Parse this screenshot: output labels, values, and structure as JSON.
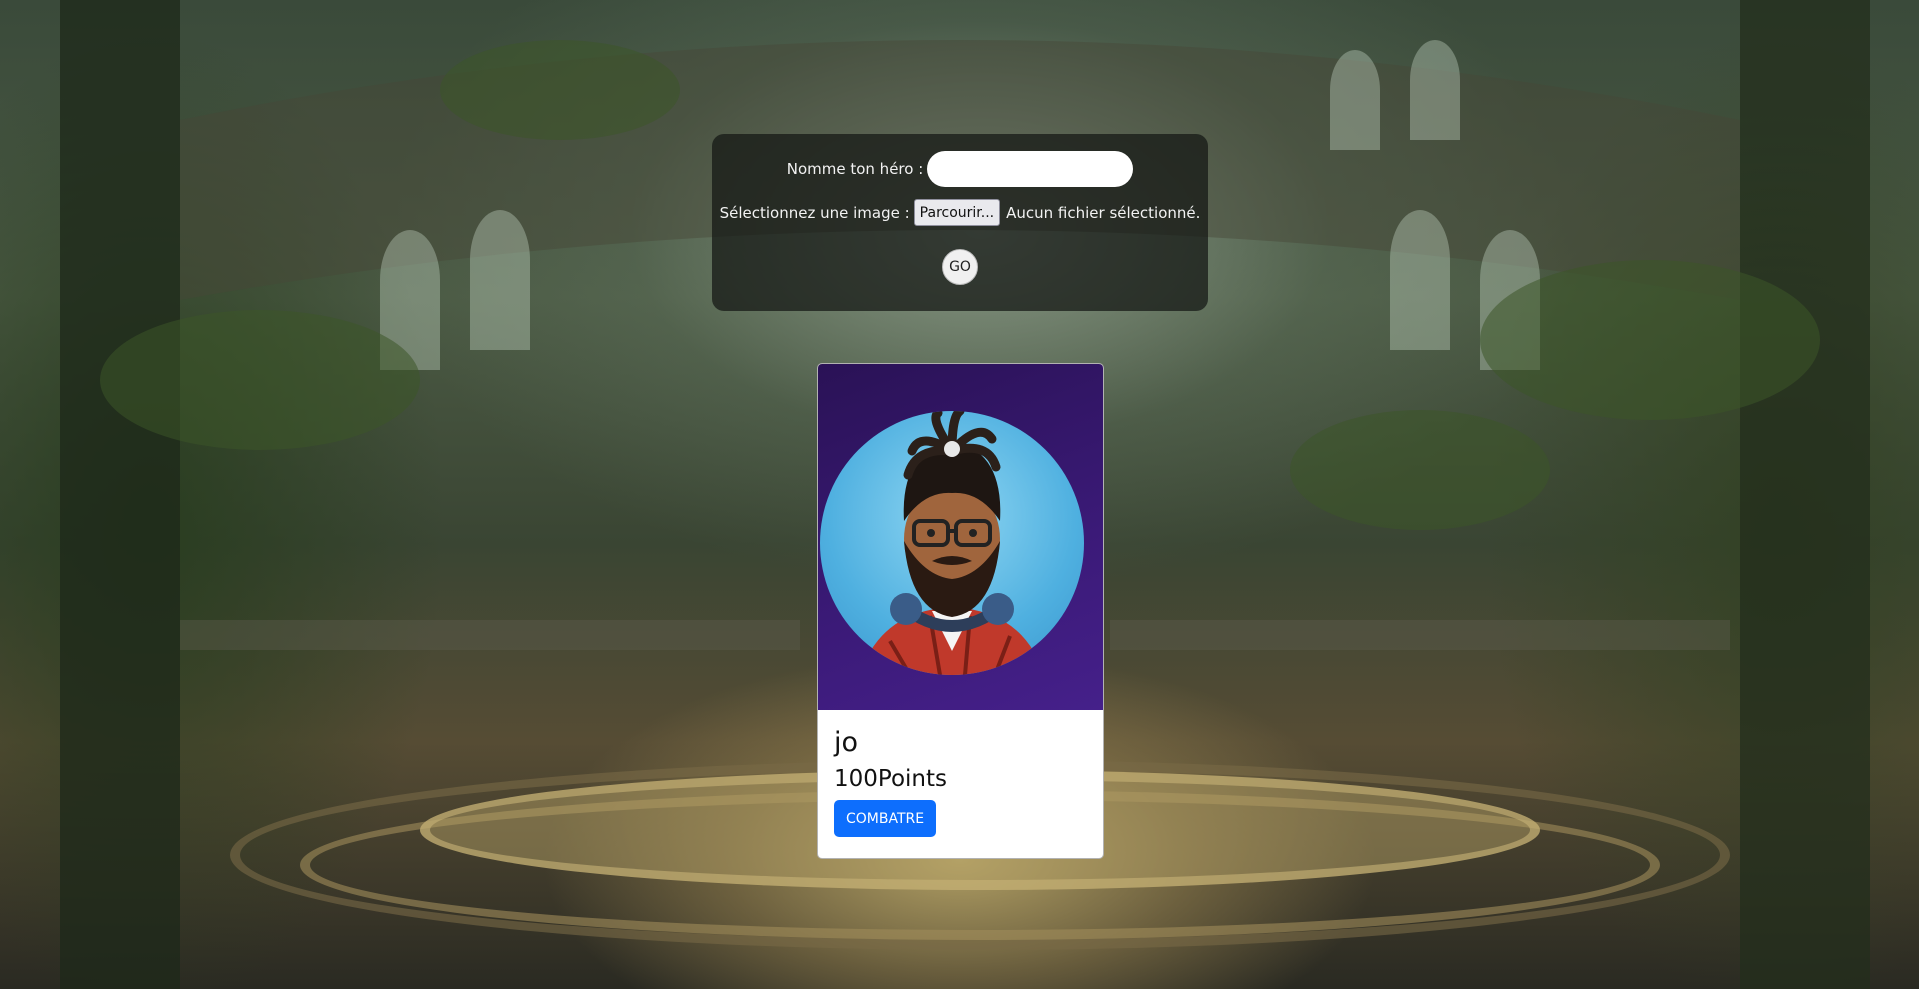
{
  "background": {
    "icon": "ancient-forest-arena-illustration"
  },
  "form": {
    "name_label": "Nomme ton héro :",
    "name_value": "",
    "name_placeholder": "",
    "image_label": "Sélectionnez une image :",
    "browse_label": "Parcourir...",
    "no_file_text": "Aucun fichier sélectionné.",
    "submit_label": "GO"
  },
  "hero_card": {
    "avatar_icon": "bearded-man-headphones-avatar",
    "name": "jo",
    "points": "100Points",
    "combat_label": "COMBATRE",
    "image_bg": "#3b1a78",
    "button_color": "#0d6efd"
  }
}
